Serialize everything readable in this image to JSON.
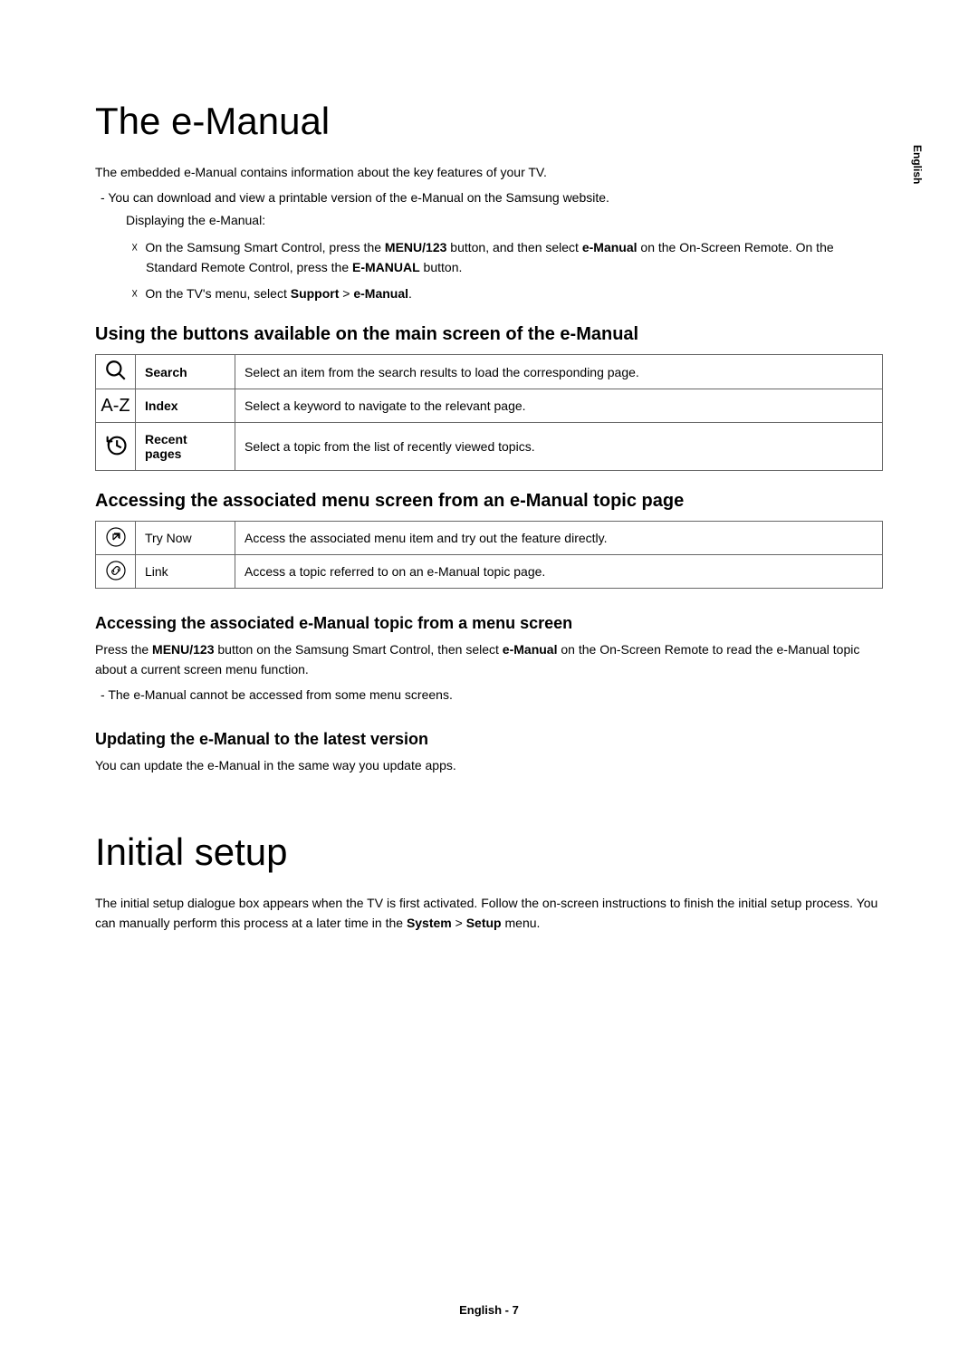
{
  "side_lang": "English",
  "h1_1": "The e-Manual",
  "intro1": "The embedded e-Manual contains information about the key features of your TV.",
  "dash1": "You can download and view a printable version of the e-Manual on the Samsung website.",
  "sub1": "Displaying the e-Manual:",
  "x1_pre": "On the Samsung Smart Control, press the ",
  "x1_b1": "MENU/123",
  "x1_mid": " button, and then select ",
  "x1_b2": "e-Manual",
  "x1_post": " on the On-Screen Remote. On the Standard Remote Control, press the ",
  "x1_b3": "E-MANUAL",
  "x1_end": " button.",
  "x2_pre": "On the TV's menu, select ",
  "x2_b1": "Support",
  "x2_gt": " > ",
  "x2_b2": "e-Manual",
  "x2_end": ".",
  "h2_1": "Using the buttons available on the main screen of the e-Manual",
  "table1": {
    "r1": {
      "label": "Search",
      "desc": "Select an item from the search results to load the corresponding page."
    },
    "r2": {
      "label": "Index",
      "desc": "Select a keyword to navigate to the relevant page."
    },
    "r3": {
      "label": "Recent pages",
      "desc": "Select a topic from the list of recently viewed topics."
    }
  },
  "h2_2": "Accessing the associated menu screen from an e-Manual topic page",
  "table2": {
    "r1": {
      "label": "Try Now",
      "desc": "Access the associated menu item and try out the feature directly."
    },
    "r2": {
      "label": "Link",
      "desc": "Access a topic referred to on an e-Manual topic page."
    }
  },
  "h3_1": "Accessing the associated e-Manual topic from a menu screen",
  "p_h3_1a_pre": "Press the ",
  "p_h3_1a_b1": "MENU/123",
  "p_h3_1a_mid": " button on the Samsung Smart Control, then select ",
  "p_h3_1a_b2": "e-Manual",
  "p_h3_1a_post": " on the On-Screen Remote to read the e-Manual topic about a current screen menu function.",
  "dash_h3_1": "The e-Manual cannot be accessed from some menu screens.",
  "h3_2": "Updating the e-Manual to the latest version",
  "p_h3_2": "You can update the e-Manual in the same way you update apps.",
  "h1_2": "Initial setup",
  "p_is_pre": "The initial setup dialogue box appears when the TV is first activated. Follow the on-screen instructions to finish the initial setup process. You can manually perform this process at a later time in the ",
  "p_is_b1": "System",
  "p_is_gt": " > ",
  "p_is_b2": "Setup",
  "p_is_end": " menu.",
  "footer": "English - 7",
  "az_text": "A-Z"
}
